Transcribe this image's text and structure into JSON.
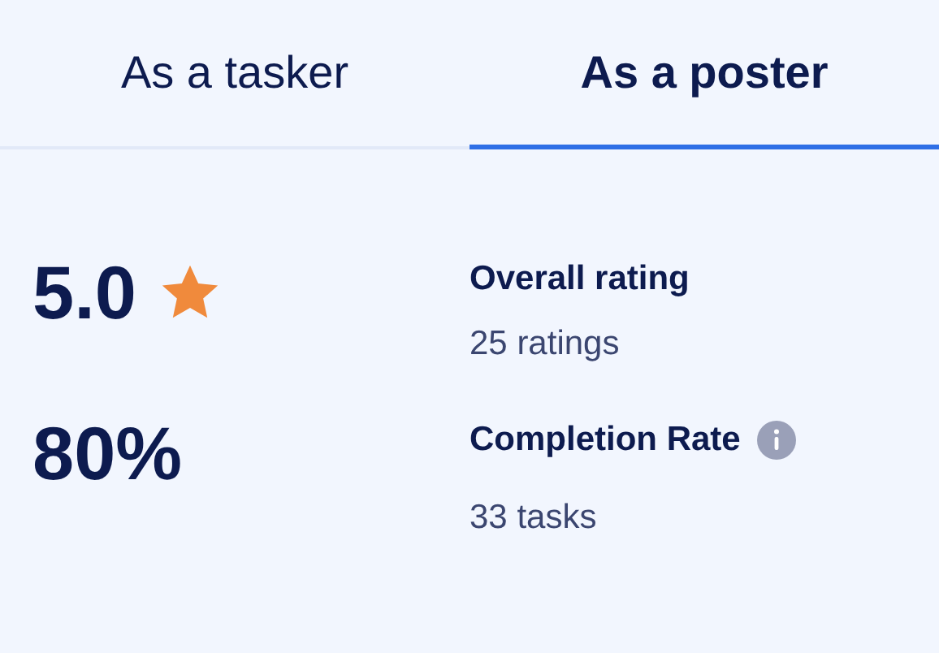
{
  "tabs": [
    {
      "label": "As a tasker",
      "selected": false
    },
    {
      "label": "As a poster",
      "selected": true
    }
  ],
  "stats": [
    {
      "value": "5.0",
      "star": true,
      "title": "Overall rating",
      "info": false,
      "detail": "25 ratings"
    },
    {
      "value": "80%",
      "star": false,
      "title": "Completion Rate",
      "info": true,
      "detail": "33 tasks"
    }
  ]
}
